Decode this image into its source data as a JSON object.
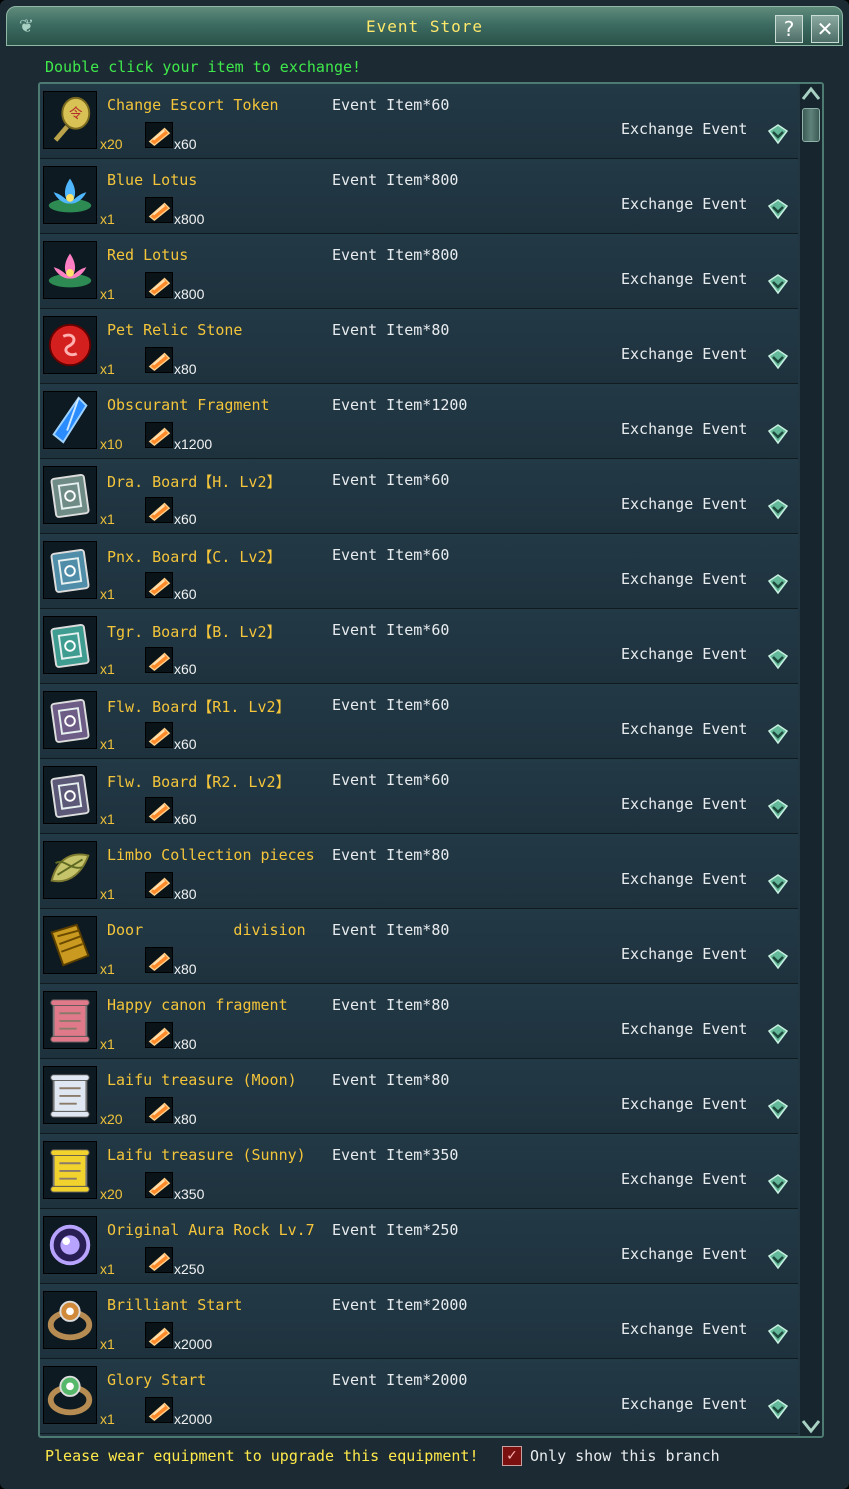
{
  "window": {
    "title": "Event Store",
    "help_label": "?",
    "close_label": "✕",
    "hint": "Double click your item to exchange!",
    "footer_hint": "Please wear equipment to upgrade this equipment!",
    "checkbox_label": "Only show this branch",
    "checkbox_checked": true
  },
  "colors": {
    "name": "#f4c53a",
    "hint": "#3fe84b",
    "footer": "#ffe94a",
    "accent": "#4d7b72"
  },
  "items": [
    {
      "name": "Change Escort Token",
      "cost_label": "Event Item*60",
      "qty": "x20",
      "cost_amount": "x60",
      "action": "Exchange Event",
      "icon": "token-icon",
      "color": "#d9c255"
    },
    {
      "name": "Blue Lotus",
      "cost_label": "Event Item*800",
      "qty": "x1",
      "cost_amount": "x800",
      "action": "Exchange Event",
      "icon": "blue-lotus-icon",
      "color": "#4fb7ff"
    },
    {
      "name": "Red Lotus",
      "cost_label": "Event Item*800",
      "qty": "x1",
      "cost_amount": "x800",
      "action": "Exchange Event",
      "icon": "red-lotus-icon",
      "color": "#ff7fc4"
    },
    {
      "name": "Pet Relic Stone",
      "cost_label": "Event Item*80",
      "qty": "x1",
      "cost_amount": "x80",
      "action": "Exchange Event",
      "icon": "relic-stone-icon",
      "color": "#d41f1f"
    },
    {
      "name": "Obscurant Fragment",
      "cost_label": "Event Item*1200",
      "qty": "x10",
      "cost_amount": "x1200",
      "action": "Exchange Event",
      "icon": "crystal-icon",
      "color": "#2a8cff"
    },
    {
      "name": "Dra. Board【H. Lv2】",
      "cost_label": "Event Item*60",
      "qty": "x1",
      "cost_amount": "x60",
      "action": "Exchange Event",
      "icon": "board-icon",
      "color": "#6f8b86"
    },
    {
      "name": "Pnx. Board【C. Lv2】",
      "cost_label": "Event Item*60",
      "qty": "x1",
      "cost_amount": "x60",
      "action": "Exchange Event",
      "icon": "board-icon",
      "color": "#4f8da8"
    },
    {
      "name": "Tgr. Board【B. Lv2】",
      "cost_label": "Event Item*60",
      "qty": "x1",
      "cost_amount": "x60",
      "action": "Exchange Event",
      "icon": "board-icon",
      "color": "#3f9c90"
    },
    {
      "name": "Flw. Board【R1. Lv2】",
      "cost_label": "Event Item*60",
      "qty": "x1",
      "cost_amount": "x60",
      "action": "Exchange Event",
      "icon": "board-icon",
      "color": "#6d5c86"
    },
    {
      "name": "Flw. Board【R2. Lv2】",
      "cost_label": "Event Item*60",
      "qty": "x1",
      "cost_amount": "x60",
      "action": "Exchange Event",
      "icon": "board-icon",
      "color": "#5c5878"
    },
    {
      "name": "Limbo Collection pieces",
      "cost_label": "Event Item*80",
      "qty": "x1",
      "cost_amount": "x80",
      "action": "Exchange Event",
      "icon": "leaves-icon",
      "color": "#c6c46a"
    },
    {
      "name": "Door          division",
      "cost_label": "Event Item*80",
      "qty": "x1",
      "cost_amount": "x80",
      "action": "Exchange Event",
      "icon": "book-icon",
      "color": "#c99a1f"
    },
    {
      "name": "Happy canon fragment",
      "cost_label": "Event Item*80",
      "qty": "x1",
      "cost_amount": "x80",
      "action": "Exchange Event",
      "icon": "scroll-icon",
      "color": "#e07a8a"
    },
    {
      "name": "Laifu treasure (Moon)",
      "cost_label": "Event Item*80",
      "qty": "x20",
      "cost_amount": "x80",
      "action": "Exchange Event",
      "icon": "scroll-icon",
      "color": "#dfe8f2"
    },
    {
      "name": "Laifu treasure (Sunny)",
      "cost_label": "Event Item*350",
      "qty": "x20",
      "cost_amount": "x350",
      "action": "Exchange Event",
      "icon": "scroll-icon",
      "color": "#f2d22c"
    },
    {
      "name": "Original Aura Rock Lv.7",
      "cost_label": "Event Item*250",
      "qty": "x1",
      "cost_amount": "x250",
      "action": "Exchange Event",
      "icon": "orb-icon",
      "color": "#b8a3ff"
    },
    {
      "name": "Brilliant Start",
      "cost_label": "Event Item*2000",
      "qty": "x1",
      "cost_amount": "x2000",
      "action": "Exchange Event",
      "icon": "ring-icon",
      "color": "#d08a3a"
    },
    {
      "name": "Glory Start",
      "cost_label": "Event Item*2000",
      "qty": "x1",
      "cost_amount": "x2000",
      "action": "Exchange Event",
      "icon": "ring-icon",
      "color": "#56b86a"
    }
  ]
}
